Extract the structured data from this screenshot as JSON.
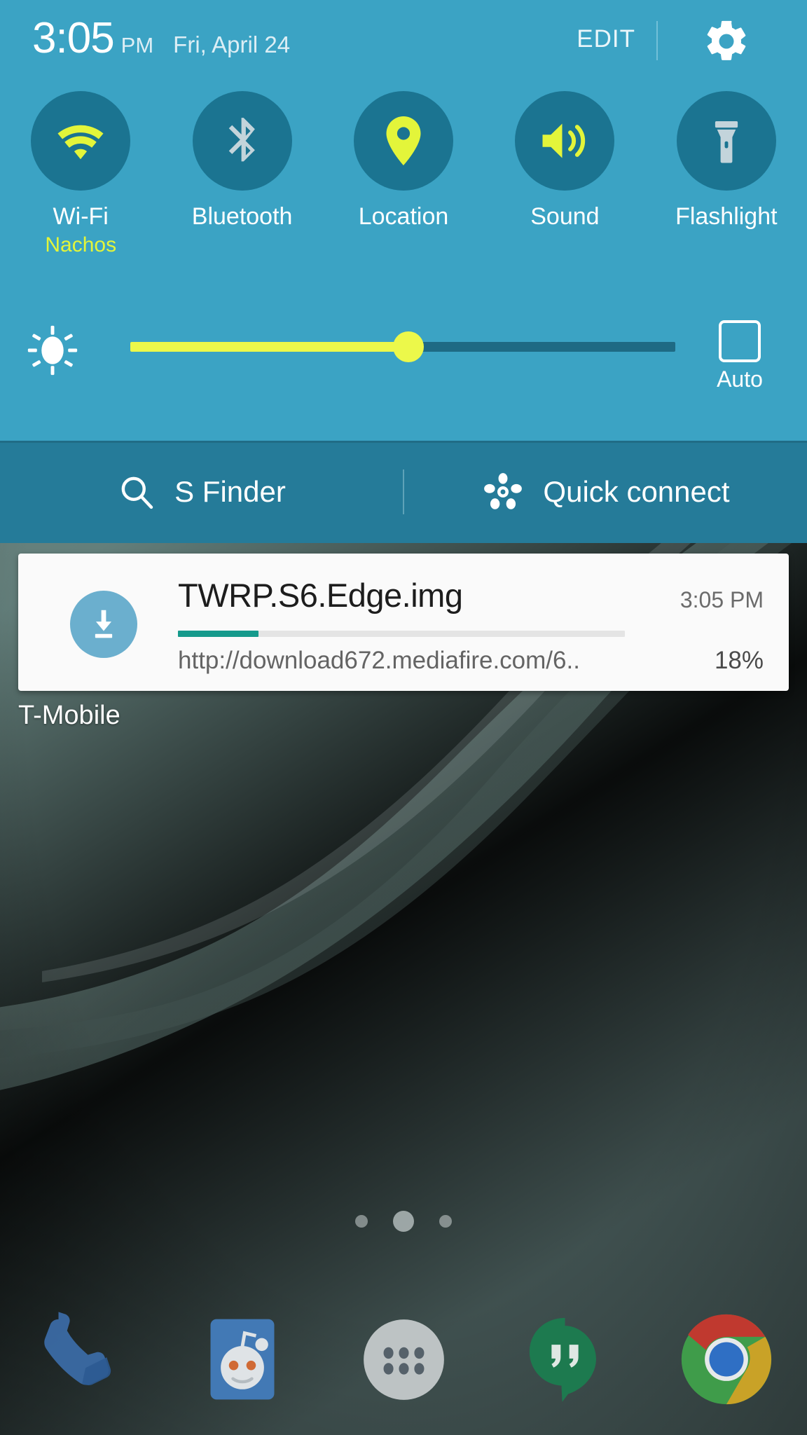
{
  "status_bar": {
    "time": "3:05",
    "ampm": "PM",
    "date": "Fri, April 24",
    "edit_label": "EDIT",
    "settings_icon": "gear-icon"
  },
  "quick_settings": {
    "toggles": [
      {
        "id": "wifi",
        "label": "Wi-Fi",
        "sublabel": "Nachos",
        "state": "on",
        "icon": "wifi-icon",
        "color": "#e3f53a"
      },
      {
        "id": "bluetooth",
        "label": "Bluetooth",
        "sublabel": "",
        "state": "off",
        "icon": "bluetooth-icon",
        "color": "#c3d4db"
      },
      {
        "id": "location",
        "label": "Location",
        "sublabel": "",
        "state": "on",
        "icon": "location-pin-icon",
        "color": "#e3f53a"
      },
      {
        "id": "sound",
        "label": "Sound",
        "sublabel": "",
        "state": "on",
        "icon": "volume-icon",
        "color": "#e3f53a"
      },
      {
        "id": "flashlight",
        "label": "Flashlight",
        "sublabel": "",
        "state": "off",
        "icon": "flashlight-icon",
        "color": "#c3d4db"
      }
    ],
    "brightness": {
      "icon": "brightness-icon",
      "value_percent": 51,
      "auto_label": "Auto",
      "auto_checked": false,
      "fill_color": "#ecf84a",
      "track_color": "#1e6a84"
    },
    "panel_color": "#3ba3c4",
    "toggle_circle_color": "#1b7491"
  },
  "finder_bar": {
    "background_color": "#257b99",
    "s_finder": {
      "label": "S Finder",
      "icon": "search-icon"
    },
    "quick_connect": {
      "label": "Quick connect",
      "icon": "quick-connect-icon"
    }
  },
  "notification": {
    "icon": "download-icon",
    "title": "TWRP.S6.Edge.img",
    "time": "3:05 PM",
    "url": "http://download672.mediafire.com/6..",
    "percent_label": "18%",
    "progress_percent": 18,
    "progress_color": "#159a8c",
    "card_color": "#fafafa"
  },
  "home_screen": {
    "carrier": "T-Mobile",
    "page_dots": {
      "count": 3,
      "active_index": 1
    },
    "dock": [
      {
        "id": "phone",
        "icon": "phone-icon"
      },
      {
        "id": "reddit",
        "icon": "reddit-icon"
      },
      {
        "id": "app-drawer",
        "icon": "apps-grid-icon"
      },
      {
        "id": "hangouts",
        "icon": "hangouts-icon"
      },
      {
        "id": "chrome",
        "icon": "chrome-icon"
      }
    ]
  }
}
